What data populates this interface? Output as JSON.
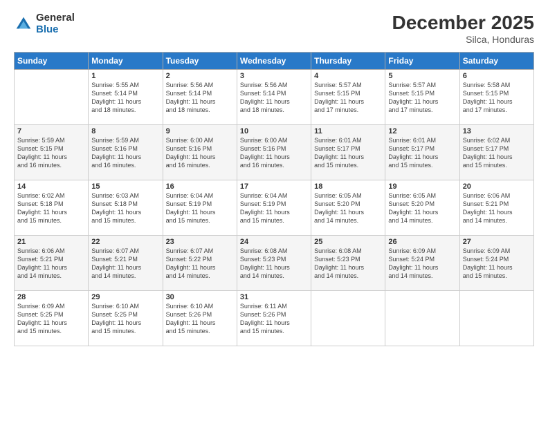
{
  "logo": {
    "general": "General",
    "blue": "Blue"
  },
  "header": {
    "month_year": "December 2025",
    "location": "Silca, Honduras"
  },
  "days_of_week": [
    "Sunday",
    "Monday",
    "Tuesday",
    "Wednesday",
    "Thursday",
    "Friday",
    "Saturday"
  ],
  "weeks": [
    [
      {
        "day": "",
        "info": ""
      },
      {
        "day": "1",
        "info": "Sunrise: 5:55 AM\nSunset: 5:14 PM\nDaylight: 11 hours\nand 18 minutes."
      },
      {
        "day": "2",
        "info": "Sunrise: 5:56 AM\nSunset: 5:14 PM\nDaylight: 11 hours\nand 18 minutes."
      },
      {
        "day": "3",
        "info": "Sunrise: 5:56 AM\nSunset: 5:14 PM\nDaylight: 11 hours\nand 18 minutes."
      },
      {
        "day": "4",
        "info": "Sunrise: 5:57 AM\nSunset: 5:15 PM\nDaylight: 11 hours\nand 17 minutes."
      },
      {
        "day": "5",
        "info": "Sunrise: 5:57 AM\nSunset: 5:15 PM\nDaylight: 11 hours\nand 17 minutes."
      },
      {
        "day": "6",
        "info": "Sunrise: 5:58 AM\nSunset: 5:15 PM\nDaylight: 11 hours\nand 17 minutes."
      }
    ],
    [
      {
        "day": "7",
        "info": "Sunrise: 5:59 AM\nSunset: 5:15 PM\nDaylight: 11 hours\nand 16 minutes."
      },
      {
        "day": "8",
        "info": "Sunrise: 5:59 AM\nSunset: 5:16 PM\nDaylight: 11 hours\nand 16 minutes."
      },
      {
        "day": "9",
        "info": "Sunrise: 6:00 AM\nSunset: 5:16 PM\nDaylight: 11 hours\nand 16 minutes."
      },
      {
        "day": "10",
        "info": "Sunrise: 6:00 AM\nSunset: 5:16 PM\nDaylight: 11 hours\nand 16 minutes."
      },
      {
        "day": "11",
        "info": "Sunrise: 6:01 AM\nSunset: 5:17 PM\nDaylight: 11 hours\nand 15 minutes."
      },
      {
        "day": "12",
        "info": "Sunrise: 6:01 AM\nSunset: 5:17 PM\nDaylight: 11 hours\nand 15 minutes."
      },
      {
        "day": "13",
        "info": "Sunrise: 6:02 AM\nSunset: 5:17 PM\nDaylight: 11 hours\nand 15 minutes."
      }
    ],
    [
      {
        "day": "14",
        "info": "Sunrise: 6:02 AM\nSunset: 5:18 PM\nDaylight: 11 hours\nand 15 minutes."
      },
      {
        "day": "15",
        "info": "Sunrise: 6:03 AM\nSunset: 5:18 PM\nDaylight: 11 hours\nand 15 minutes."
      },
      {
        "day": "16",
        "info": "Sunrise: 6:04 AM\nSunset: 5:19 PM\nDaylight: 11 hours\nand 15 minutes."
      },
      {
        "day": "17",
        "info": "Sunrise: 6:04 AM\nSunset: 5:19 PM\nDaylight: 11 hours\nand 15 minutes."
      },
      {
        "day": "18",
        "info": "Sunrise: 6:05 AM\nSunset: 5:20 PM\nDaylight: 11 hours\nand 14 minutes."
      },
      {
        "day": "19",
        "info": "Sunrise: 6:05 AM\nSunset: 5:20 PM\nDaylight: 11 hours\nand 14 minutes."
      },
      {
        "day": "20",
        "info": "Sunrise: 6:06 AM\nSunset: 5:21 PM\nDaylight: 11 hours\nand 14 minutes."
      }
    ],
    [
      {
        "day": "21",
        "info": "Sunrise: 6:06 AM\nSunset: 5:21 PM\nDaylight: 11 hours\nand 14 minutes."
      },
      {
        "day": "22",
        "info": "Sunrise: 6:07 AM\nSunset: 5:21 PM\nDaylight: 11 hours\nand 14 minutes."
      },
      {
        "day": "23",
        "info": "Sunrise: 6:07 AM\nSunset: 5:22 PM\nDaylight: 11 hours\nand 14 minutes."
      },
      {
        "day": "24",
        "info": "Sunrise: 6:08 AM\nSunset: 5:23 PM\nDaylight: 11 hours\nand 14 minutes."
      },
      {
        "day": "25",
        "info": "Sunrise: 6:08 AM\nSunset: 5:23 PM\nDaylight: 11 hours\nand 14 minutes."
      },
      {
        "day": "26",
        "info": "Sunrise: 6:09 AM\nSunset: 5:24 PM\nDaylight: 11 hours\nand 14 minutes."
      },
      {
        "day": "27",
        "info": "Sunrise: 6:09 AM\nSunset: 5:24 PM\nDaylight: 11 hours\nand 15 minutes."
      }
    ],
    [
      {
        "day": "28",
        "info": "Sunrise: 6:09 AM\nSunset: 5:25 PM\nDaylight: 11 hours\nand 15 minutes."
      },
      {
        "day": "29",
        "info": "Sunrise: 6:10 AM\nSunset: 5:25 PM\nDaylight: 11 hours\nand 15 minutes."
      },
      {
        "day": "30",
        "info": "Sunrise: 6:10 AM\nSunset: 5:26 PM\nDaylight: 11 hours\nand 15 minutes."
      },
      {
        "day": "31",
        "info": "Sunrise: 6:11 AM\nSunset: 5:26 PM\nDaylight: 11 hours\nand 15 minutes."
      },
      {
        "day": "",
        "info": ""
      },
      {
        "day": "",
        "info": ""
      },
      {
        "day": "",
        "info": ""
      }
    ]
  ]
}
